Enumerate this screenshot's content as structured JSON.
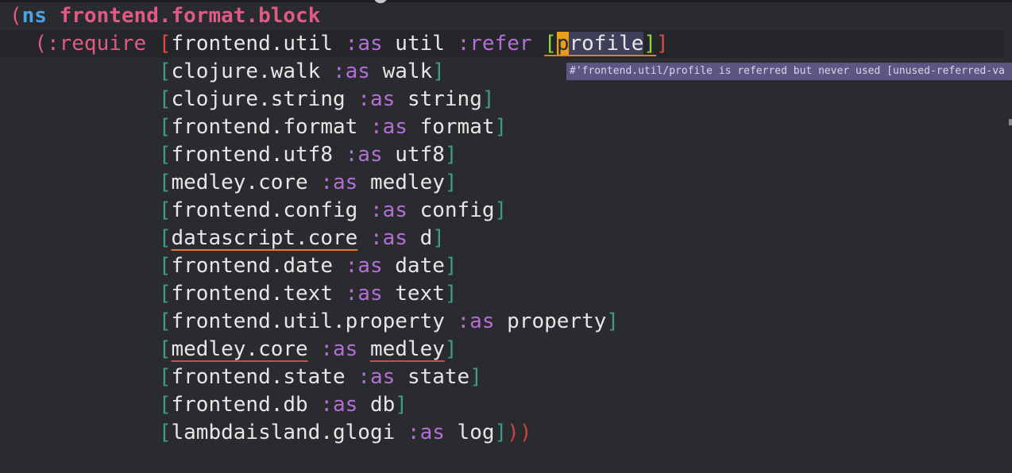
{
  "editor": {
    "ns_open_paren": "(",
    "ns_keyword": "ns",
    "ns_name": "frontend.format.block",
    "require_open": "(:require",
    "lines": [
      {
        "lib": "frontend.util",
        "kw": ":as",
        "alias": "util",
        "refer_kw": ":refer",
        "refer_sym": "profile"
      },
      {
        "lib": "clojure.walk",
        "kw": ":as",
        "alias": "walk"
      },
      {
        "lib": "clojure.string",
        "kw": ":as",
        "alias": "string"
      },
      {
        "lib": "frontend.format",
        "kw": ":as",
        "alias": "format"
      },
      {
        "lib": "frontend.utf8",
        "kw": ":as",
        "alias": "utf8"
      },
      {
        "lib": "medley.core",
        "kw": ":as",
        "alias": "medley"
      },
      {
        "lib": "frontend.config",
        "kw": ":as",
        "alias": "config"
      },
      {
        "lib": "datascript.core",
        "kw": ":as",
        "alias": "d"
      },
      {
        "lib": "frontend.date",
        "kw": ":as",
        "alias": "date"
      },
      {
        "lib": "frontend.text",
        "kw": ":as",
        "alias": "text"
      },
      {
        "lib": "frontend.util.property",
        "kw": ":as",
        "alias": "property"
      },
      {
        "lib": "medley.core",
        "kw": ":as",
        "alias": "medley"
      },
      {
        "lib": "frontend.state",
        "kw": ":as",
        "alias": "state"
      },
      {
        "lib": "frontend.db",
        "kw": ":as",
        "alias": "db"
      },
      {
        "lib": "lambdaisland.glogi",
        "kw": ":as",
        "alias": "log"
      }
    ],
    "close_parens": "))"
  },
  "tooltip": {
    "text": "#'frontend.util/profile is referred but never used [unused-referred-va"
  },
  "colors": {
    "background": "#2a2b2f",
    "keyword": "#b36fd6",
    "ns_name": "#e05a86",
    "tooltip_bg": "#5b5682"
  }
}
